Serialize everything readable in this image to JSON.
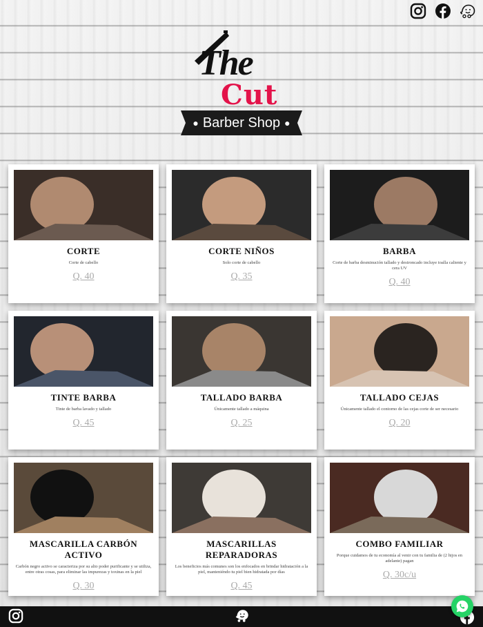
{
  "brand": {
    "logo_line1": "The",
    "logo_line2": "Cut",
    "logo_banner": "Barber Shop",
    "accent_color": "#e3134a"
  },
  "header_icons": [
    "instagram-icon",
    "facebook-icon",
    "waze-icon"
  ],
  "services": [
    {
      "name": "CORTE",
      "description": "Corte de cabello",
      "price": "Q. 40",
      "photo_tones": [
        "#3a2e28",
        "#b08a70",
        "#6b5a50"
      ]
    },
    {
      "name": "CORTE NIÑOS",
      "description": "Solo corte de cabello",
      "price": "Q. 35",
      "photo_tones": [
        "#2b2b2b",
        "#c49b7e",
        "#5a4a3e"
      ]
    },
    {
      "name": "BARBA",
      "description": "Corte de barba desminución tallado y destroncado incluye toalla caliente y cera UV",
      "price": "Q. 40",
      "photo_tones": [
        "#1c1c1c",
        "#9c7a64",
        "#3c3c3c"
      ]
    },
    {
      "name": "TINTE BARBA",
      "description": "Tinte de barba lavado y tallado",
      "price": "Q. 45",
      "photo_tones": [
        "#22262e",
        "#b89078",
        "#4a5568"
      ]
    },
    {
      "name": "TALLADO BARBA",
      "description": "Únicamente tallado a máquina",
      "price": "Q. 25",
      "photo_tones": [
        "#3a3632",
        "#a88468",
        "#8a8a8a"
      ]
    },
    {
      "name": "TALLADO CEJAS",
      "description": "Únicamente tallado el contorno de las cejas corte de ser necesario",
      "price": "Q. 20",
      "photo_tones": [
        "#c9a88e",
        "#2a2420",
        "#d7c3b2"
      ]
    },
    {
      "name": "MASCARILLA CARBÓN ACTIVO",
      "description": "Carbón negro activo se caracteriza por su alto poder purificante y se utiliza, entre otras cosas, para eliminar las impurezas y toxinas en la piel",
      "price": "Q. 30",
      "photo_tones": [
        "#5a4a3a",
        "#111111",
        "#a08060"
      ]
    },
    {
      "name": "MASCARILLAS REPARADORAS",
      "description": "Los beneficios más comunes son los enfocados en brindar hidratación a la piel, manteniéndo tu piel bien hidratada por días",
      "price": "Q. 45",
      "photo_tones": [
        "#3e3a36",
        "#e8e2da",
        "#8a7060"
      ]
    },
    {
      "name": "COMBO FAMILIAR",
      "description": "Porque cuidamos de tu economía al venir con tu familia de (2 hijos en adelante) pagan",
      "price": "Q. 30c/u",
      "photo_tones": [
        "#4a2a22",
        "#d8d8d8",
        "#7a6a5a"
      ]
    }
  ],
  "footer_icons": [
    "instagram-icon",
    "waze-icon",
    "facebook-icon"
  ],
  "whatsapp_color": "#25d366"
}
